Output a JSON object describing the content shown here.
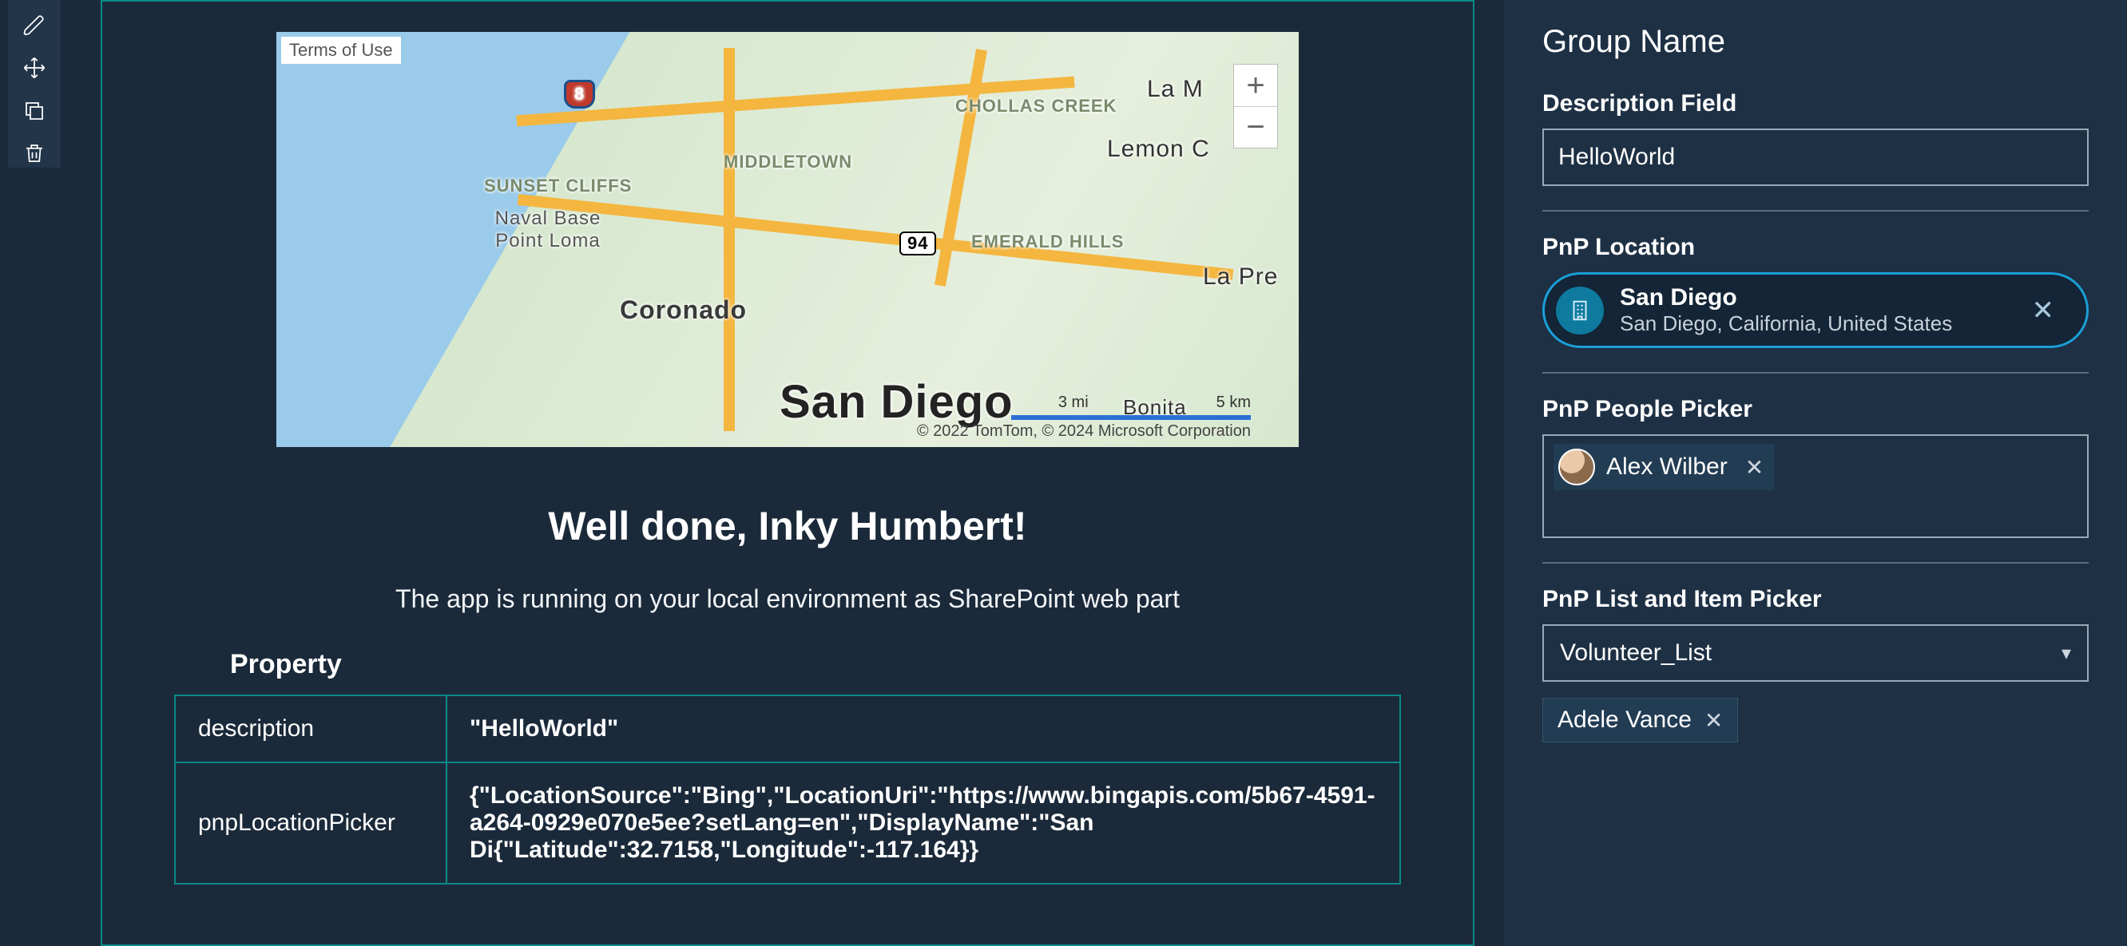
{
  "toolbar": {
    "edit": "edit",
    "move": "move",
    "duplicate": "duplicate",
    "delete": "delete"
  },
  "map": {
    "terms_label": "Terms of Use",
    "zoom_in": "+",
    "zoom_out": "−",
    "labels": {
      "san_diego": "San Diego",
      "coronado": "Coronado",
      "sunset_cliffs": "SUNSET CLIFFS",
      "naval_base": "Naval Base Point Loma",
      "middletown": "MIDDLETOWN",
      "chollas_creek": "CHOLLAS CREEK",
      "emerald_hills": "EMERALD HILLS",
      "lemon": "Lemon C",
      "la_m": "La M",
      "la_pre": "La Pre",
      "bonita": "Bonita",
      "hwy8": "8",
      "hwy94": "94"
    },
    "scale_3mi": "3 mi",
    "scale_5km": "5 km",
    "copyright": "© 2022 TomTom, © 2024 Microsoft Corporation"
  },
  "webpart": {
    "headline": "Well done, Inky Humbert!",
    "subline": "The app is running on your local environment as SharePoint web part",
    "property_header": "Property",
    "rows": [
      {
        "key": "description",
        "value": "\"HelloWorld\""
      },
      {
        "key": "pnpLocationPicker",
        "value": "{\"LocationSource\":\"Bing\",\"LocationUri\":\"https://www.bingapis.com/5b67-4591-a264-0929e070e5ee?setLang=en\",\"DisplayName\":\"San Di{\"Latitude\":32.7158,\"Longitude\":-117.164}}"
      }
    ]
  },
  "pane": {
    "group_title": "Group Name",
    "description": {
      "label": "Description Field",
      "value": "HelloWorld"
    },
    "location": {
      "label": "PnP Location",
      "title": "San Diego",
      "subtitle": "San Diego, California, United States"
    },
    "people": {
      "label": "PnP People Picker",
      "person": "Alex Wilber"
    },
    "list": {
      "label": "PnP List and Item Picker",
      "selected_list": "Volunteer_List",
      "selected_item": "Adele Vance"
    }
  }
}
